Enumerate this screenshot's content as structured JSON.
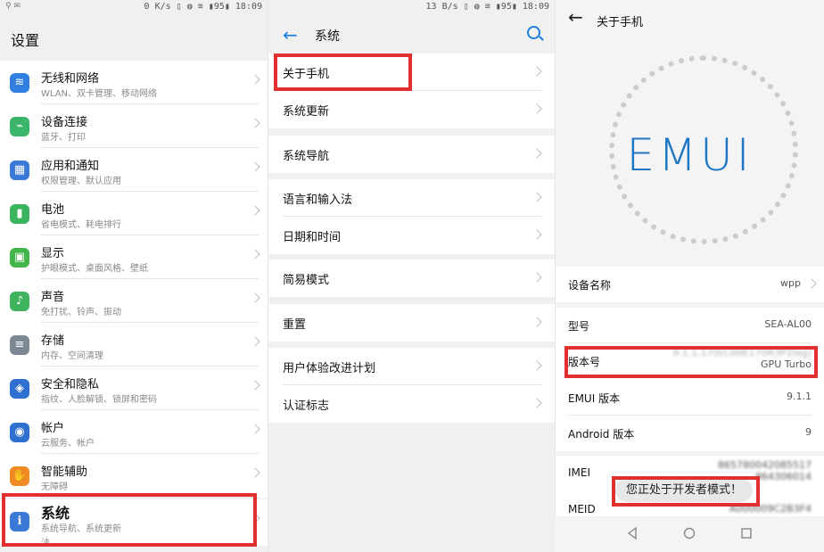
{
  "panel1": {
    "status_left": "⚲ ✉",
    "status_right": "0 K/s ▯ ◍ ≋ ▮95▮ 18:09",
    "title": "设置",
    "items": [
      {
        "title": "无线和网络",
        "sub": "WLAN、双卡管理、移动网络",
        "icon": "wifi-icon",
        "color": "#2f7ee0",
        "glyph": "≋"
      },
      {
        "title": "设备连接",
        "sub": "蓝牙、打印",
        "icon": "device-link-icon",
        "color": "#3bb56a",
        "glyph": "⌁"
      },
      {
        "title": "应用和通知",
        "sub": "权限管理、默认应用",
        "icon": "apps-icon",
        "color": "#3a7ad6",
        "glyph": "▦"
      },
      {
        "title": "电池",
        "sub": "省电模式、耗电排行",
        "icon": "battery-icon",
        "color": "#3ab55d",
        "glyph": "▮"
      },
      {
        "title": "显示",
        "sub": "护眼模式、桌面风格、壁纸",
        "icon": "display-icon",
        "color": "#43b54a",
        "glyph": "▣"
      },
      {
        "title": "声音",
        "sub": "免打扰、铃声、振动",
        "icon": "sound-icon",
        "color": "#40b35e",
        "glyph": "♪"
      },
      {
        "title": "存储",
        "sub": "内存、空间清理",
        "icon": "storage-icon",
        "color": "#7d8895",
        "glyph": "≡"
      },
      {
        "title": "安全和隐私",
        "sub": "指纹、人脸解锁、锁屏和密码",
        "icon": "shield-icon",
        "color": "#2f6fcf",
        "glyph": "◈"
      },
      {
        "title": "帐户",
        "sub": "云服务、帐户",
        "icon": "account-icon",
        "color": "#2f6fcf",
        "glyph": "◉"
      },
      {
        "title": "智能辅助",
        "sub": "无障碍",
        "icon": "hand-icon",
        "color": "#f08a24",
        "glyph": "✋"
      },
      {
        "title": "系统",
        "sub": "系统导航、系统更新",
        "sub2": "法",
        "icon": "system-icon",
        "color": "#3a7ad6",
        "glyph": "ℹ"
      }
    ]
  },
  "panel2": {
    "status_right": "13 B/s ▯ ◍ ≋ ▮95▮ 18:09",
    "title": "系统",
    "groups": [
      [
        "关于手机",
        "系统更新"
      ],
      [
        "系统导航"
      ],
      [
        "语言和输入法",
        "日期和时间"
      ],
      [
        "简易模式"
      ],
      [
        "重置"
      ],
      [
        "用户体验改进计划",
        "认证标志"
      ]
    ]
  },
  "panel3": {
    "title": "关于手机",
    "logo": "EMUI",
    "rows": [
      {
        "k": "设备名称",
        "v": "wpp"
      },
      {
        "k": "型号",
        "v": "SEA-AL00"
      },
      {
        "k": "版本号",
        "v": "9.1.1.170(C00E170R3P2log)",
        "v2": "GPU Turbo"
      },
      {
        "k": "EMUI 版本",
        "v": "9.1.1"
      },
      {
        "k": "Android 版本",
        "v": "9"
      },
      {
        "k": "IMEI",
        "v": "865780042085517",
        "v2": "864306014"
      },
      {
        "k": "MEID",
        "v": "A000009C2B3F4"
      }
    ],
    "toast": "您正处于开发者模式！"
  }
}
